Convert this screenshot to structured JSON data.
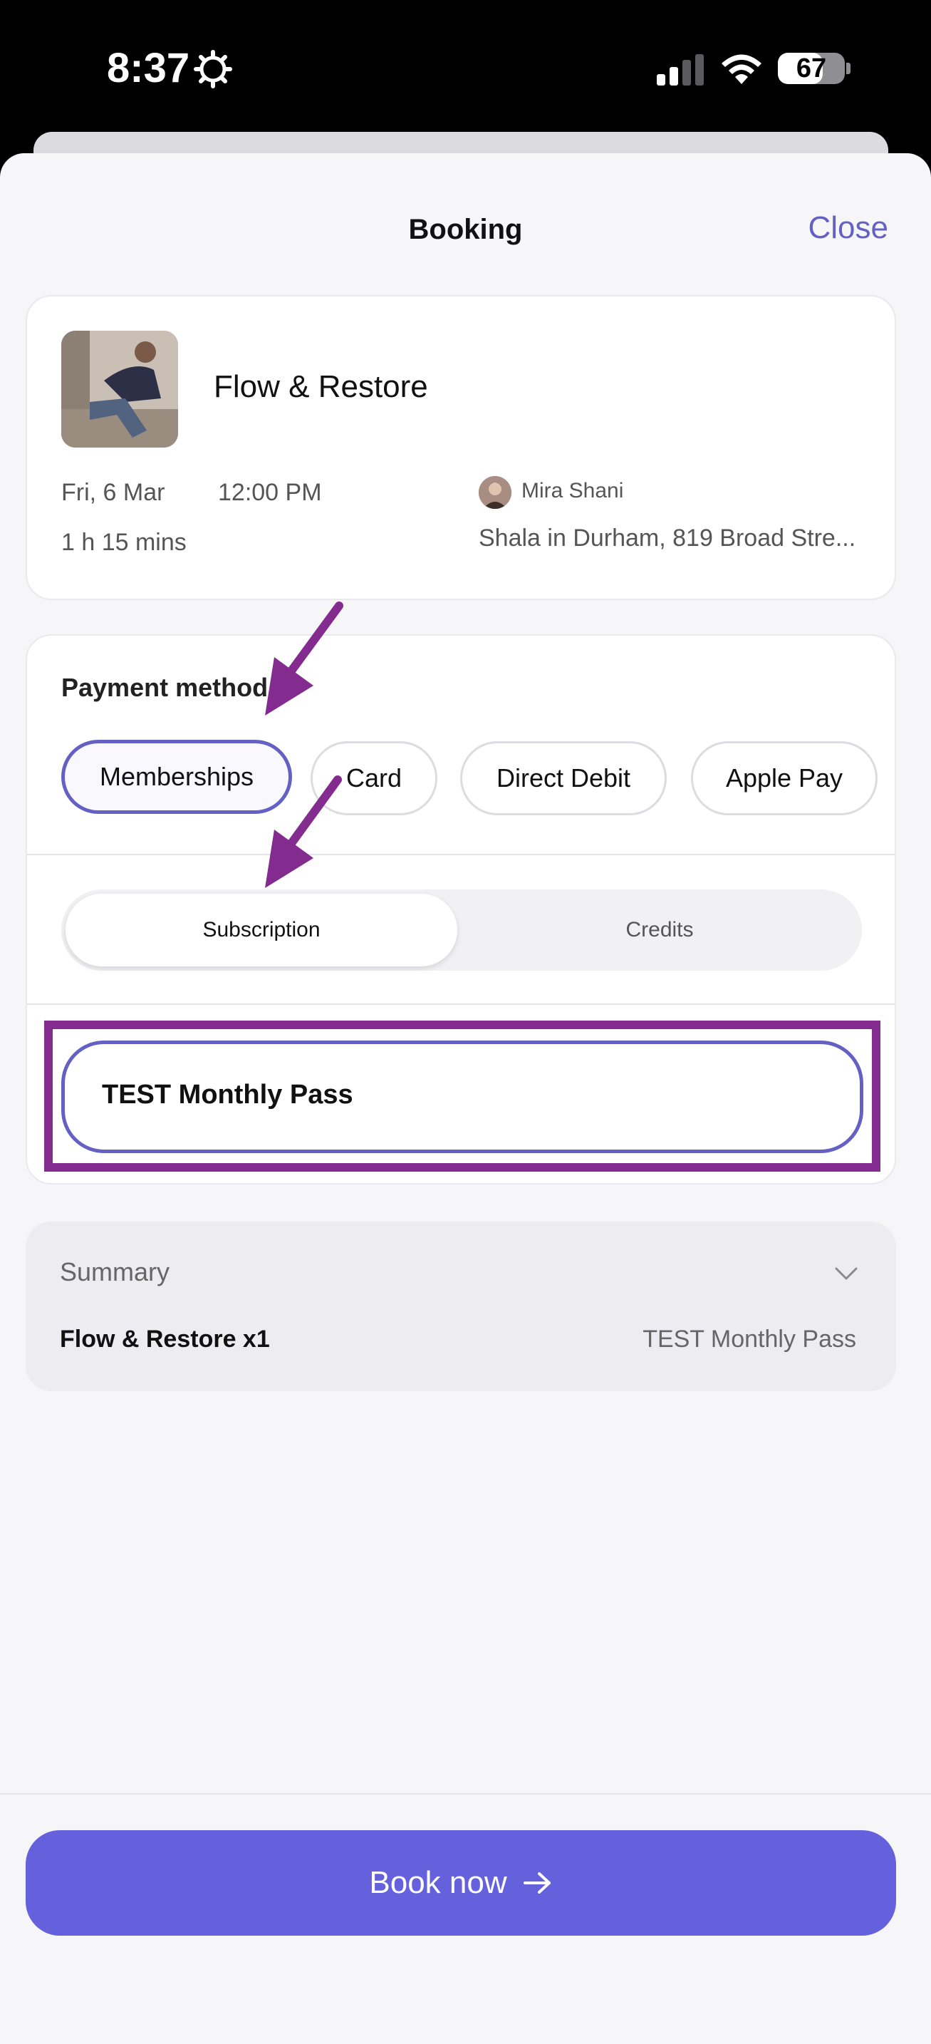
{
  "status_bar": {
    "time": "8:37",
    "battery": "67",
    "battery_level": 0.67
  },
  "header": {
    "title": "Booking",
    "close_label": "Close"
  },
  "class_card": {
    "name": "Flow & Restore",
    "date": "Fri, 6 Mar",
    "time": "12:00 PM",
    "duration": "1 h 15 mins",
    "instructor": "Mira Shani",
    "location": "Shala in Durham, 819 Broad Stre..."
  },
  "payment": {
    "title": "Payment method",
    "methods": [
      "Memberships",
      "Card",
      "Direct Debit",
      "Apple Pay"
    ],
    "selected_method": "Memberships",
    "tabs": [
      "Subscription",
      "Credits"
    ],
    "selected_tab": "Subscription",
    "pass_option": "TEST Monthly Pass"
  },
  "summary": {
    "title": "Summary",
    "item_label": "Flow & Restore x1",
    "item_value": "TEST Monthly Pass"
  },
  "book_button": {
    "label": "Book now"
  },
  "colors": {
    "accent": "#6561c4",
    "button": "#6561dc",
    "annotation": "#832b8e"
  }
}
